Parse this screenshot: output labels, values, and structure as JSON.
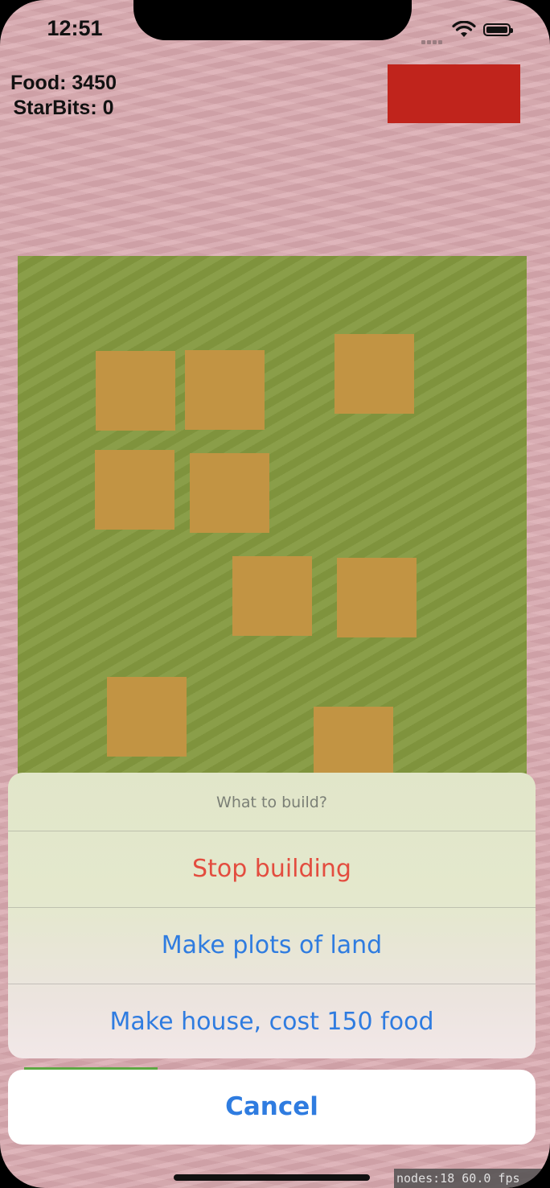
{
  "status_bar": {
    "time": "12:51",
    "icons": [
      "cellular-signal-icon",
      "wifi-icon",
      "battery-icon"
    ]
  },
  "hud": {
    "food_label": "Food: 3450",
    "starbits_label": "StarBits: 0"
  },
  "colors": {
    "background": "#d9a8ae",
    "field": "#84993f",
    "plot": "#c29443",
    "red_button": "#c0241c",
    "action_blue": "#2f7ce0",
    "destructive_red": "#e34d3f"
  },
  "action_sheet": {
    "title": "What to build?",
    "actions": [
      {
        "label": "Stop building",
        "style": "destructive"
      },
      {
        "label": "Make plots of land",
        "style": "default"
      },
      {
        "label": "Make house, cost 150 food",
        "style": "default"
      }
    ],
    "cancel_label": "Cancel"
  },
  "debug_stats": "nodes:18  60.0 fps"
}
